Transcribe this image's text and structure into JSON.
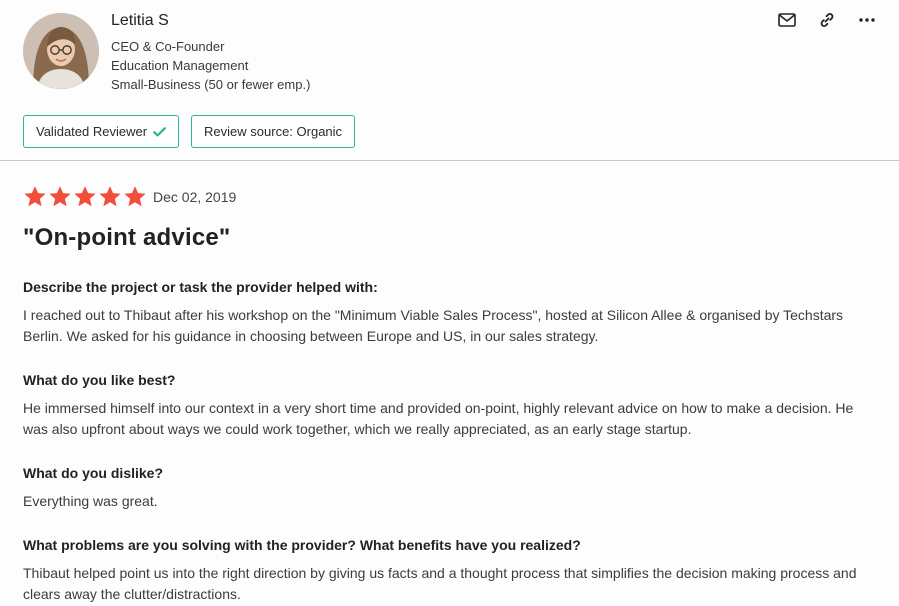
{
  "reviewer": {
    "name": "Letitia S",
    "title": "CEO & Co-Founder",
    "industry": "Education Management",
    "company_size": "Small-Business (50 or fewer emp.)"
  },
  "actions": {
    "icons": [
      "mail-icon",
      "link-icon",
      "more-icon"
    ]
  },
  "badges": {
    "validated": "Validated Reviewer",
    "source": "Review source: Organic"
  },
  "review": {
    "rating": 5,
    "rating_max": 5,
    "date": "Dec 02, 2019",
    "title": "\"On-point advice\"",
    "star_color": "#f24e3c",
    "qa": [
      {
        "question": "Describe the project or task the provider helped with:",
        "answer": "I reached out to Thibaut after his workshop on the \"Minimum Viable Sales Process\", hosted at Silicon Allee & organised by Techstars Berlin. We asked for his guidance in choosing between Europe and US, in our sales strategy."
      },
      {
        "question": "What do you like best?",
        "answer": "He immersed himself into our context in a very short time and provided on-point, highly relevant advice on how to make a decision. He was also upfront about ways we could work together, which we really appreciated, as an early stage startup."
      },
      {
        "question": "What do you dislike?",
        "answer": "Everything was great."
      },
      {
        "question": "What problems are you solving with the provider? What benefits have you realized?",
        "answer": "Thibaut helped point us into the right direction by giving us facts and a thought process that simplifies the decision making process and clears away the clutter/distractions."
      }
    ]
  }
}
